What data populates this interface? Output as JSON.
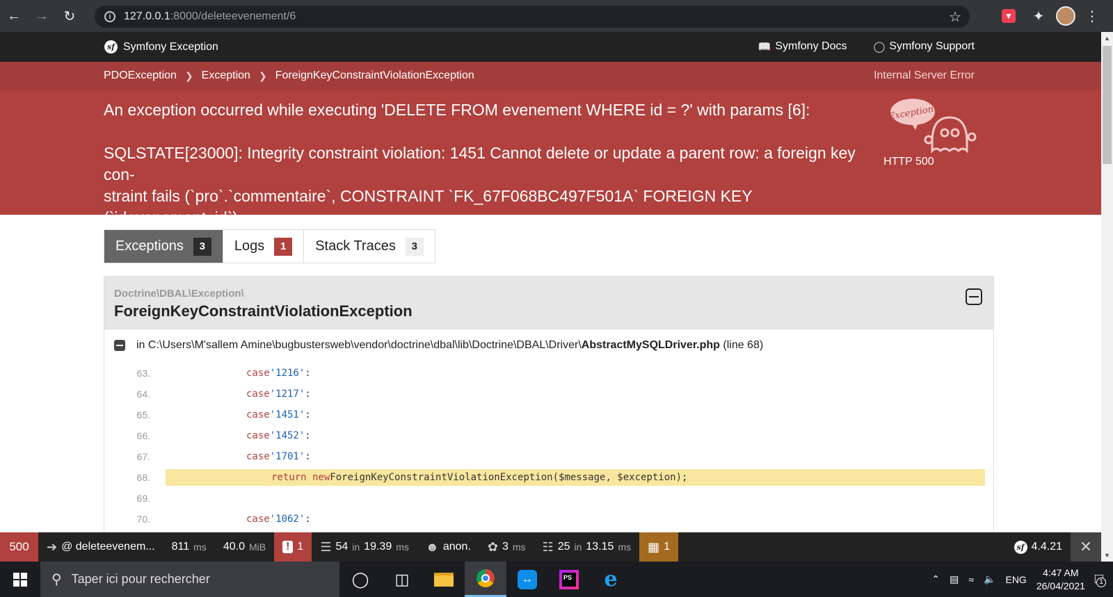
{
  "browser": {
    "url_host": "127.0.0.1",
    "url_path": ":8000/deleteevenement/6"
  },
  "header": {
    "title": "Symfony Exception",
    "links": [
      "Symfony Docs",
      "Symfony Support"
    ]
  },
  "breadcrumb": {
    "items": [
      "PDOException",
      "Exception",
      "ForeignKeyConstraintViolationException"
    ],
    "status_code": "HTTP 500",
    "status_text": "Internal Server Error"
  },
  "exception": {
    "message": "An exception occurred while executing 'DELETE FROM evenement WHERE id = ?' with params [6]:\n\nSQLSTATE[23000]: Integrity constraint violation: 1451 Cannot delete or update a parent row: a foreign key con-\nstraint fails (`pro`.`commentaire`, CONSTRAINT `FK_67F068BC497F501A` FOREIGN KEY (`idevenement_id`)\nREFERENCES `evenement` (`id`))",
    "ghost_label": "Exception!"
  },
  "tabs": [
    {
      "label": "Exceptions",
      "count": "3"
    },
    {
      "label": "Logs",
      "count": "1"
    },
    {
      "label": "Stack Traces",
      "count": "3"
    }
  ],
  "trace": {
    "namespace": "Doctrine\\DBAL\\Exception\\",
    "class": "ForeignKeyConstraintViolationException",
    "file_prefix": "in C:\\Users\\M'sallem Amine\\bugbustersweb\\vendor\\doctrine\\dbal\\lib\\Doctrine\\DBAL\\Driver\\",
    "file_name": "AbstractMySQLDriver.php",
    "file_line": "(line 68)",
    "lines": [
      {
        "num": "63.",
        "kw": "case",
        "rest": "'1216'",
        "tail": ":"
      },
      {
        "num": "64.",
        "kw": "case",
        "rest": "'1217'",
        "tail": ":"
      },
      {
        "num": "65.",
        "kw": "case",
        "rest": "'1451'",
        "tail": ":"
      },
      {
        "num": "66.",
        "kw": "case",
        "rest": "'1452'",
        "tail": ":"
      },
      {
        "num": "67.",
        "kw": "case",
        "rest": "'1701'",
        "tail": ":"
      },
      {
        "num": "68.",
        "kw": "return new",
        "rest": "ForeignKeyConstraintViolationException($message, $exception);",
        "tail": ""
      },
      {
        "num": "69.",
        "kw": "",
        "rest": "",
        "tail": ""
      },
      {
        "num": "70.",
        "kw": "case",
        "rest": "'1062'",
        "tail": ":"
      }
    ]
  },
  "toolbar": {
    "status": "500",
    "route": "@ deleteevenem...",
    "time": "811",
    "time_unit": "ms",
    "memory": "40.0",
    "memory_unit": "MiB",
    "errors": "1",
    "forms_count": "54",
    "forms_in": "in",
    "forms_time": "19.39",
    "forms_unit": "ms",
    "user": "anon.",
    "twig_time": "3",
    "twig_unit": "ms",
    "db_count": "25",
    "db_in": "in",
    "db_time": "13.15",
    "db_unit": "ms",
    "translation": "1",
    "version": "4.4.21"
  },
  "taskbar": {
    "search_placeholder": "Taper ici pour rechercher",
    "lang": "ENG",
    "time": "4:47 AM",
    "date": "26/04/2021",
    "notifications": "1"
  }
}
